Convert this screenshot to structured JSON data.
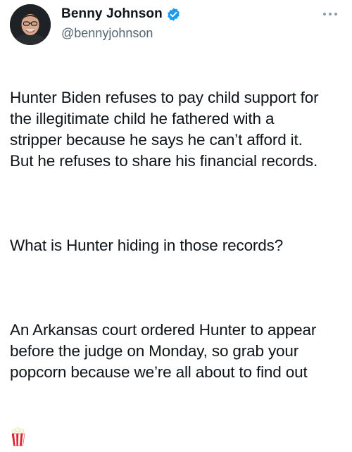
{
  "author": {
    "display_name": "Benny Johnson",
    "handle": "@bennyjohnson",
    "verified": true,
    "verified_color": "#1d9bf0"
  },
  "menu": {
    "icon": "more-horizontal-icon"
  },
  "tweet": {
    "paragraphs": [
      "Hunter Biden refuses to pay child support for\nthe illegitimate child he fathered with a\nstripper because he says he can’t afford it.\nBut he refuses to share his financial records.",
      "What is Hunter hiding in those records?",
      "An Arkansas court ordered Hunter to appear\nbefore the judge on Monday, so grab your\npopcorn because we’re all about to find out"
    ],
    "trailing_emoji": "popcorn-icon"
  }
}
